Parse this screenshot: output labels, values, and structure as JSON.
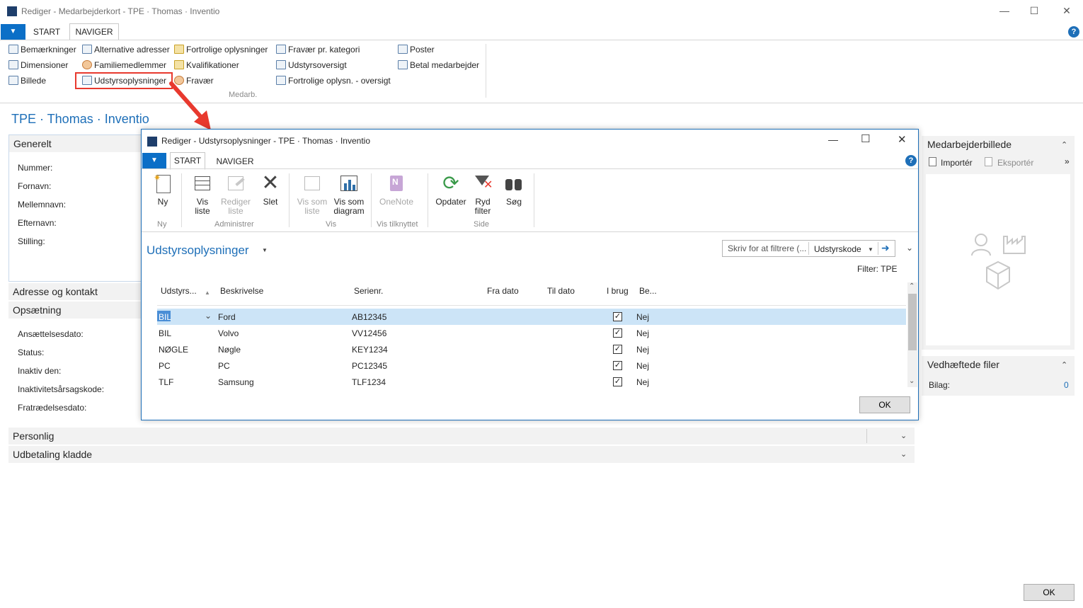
{
  "main_window": {
    "title": "Rediger - Medarbejderkort - TPE · Thomas · Inventio",
    "tabs": [
      "START",
      "NAVIGER"
    ],
    "active_tab": "NAVIGER",
    "ribbon": {
      "col1": [
        "Bemærkninger",
        "Dimensioner",
        "Billede"
      ],
      "col2": [
        "Alternative adresser",
        "Familiemedlemmer",
        "Udstyrsoplysninger"
      ],
      "col3": [
        "Fortrolige oplysninger",
        "Kvalifikationer",
        "Fravær"
      ],
      "col4": [
        "Fravær pr. kategori",
        "Udstyrsoversigt",
        "Fortrolige oplysn. - oversigt"
      ],
      "col5": [
        "Poster",
        "Betal medarbejder"
      ],
      "group_label": "Medarb."
    },
    "page_title": "TPE · Thomas  · Inventio",
    "fasttabs": {
      "generelt": "Generelt",
      "generelt_fields": [
        "Nummer:",
        "Fornavn:",
        "Mellemnavn:",
        "Efternavn:",
        "Stilling:"
      ],
      "adresse": "Adresse og kontakt",
      "opsaetning": "Opsætning",
      "opsaetning_fields": [
        "Ansættelsesdato:",
        "Status:",
        "Inaktiv den:",
        "Inaktivitetsårsagskode:",
        "Fratrædelsesdato:"
      ],
      "personlig": "Personlig",
      "udbetaling": "Udbetaling kladde"
    },
    "factbox": {
      "picture_title": "Medarbejderbillede",
      "import_label": "Importér",
      "export_label": "Eksportér",
      "attachments_title": "Vedhæftede filer",
      "bilag_label": "Bilag:",
      "bilag_value": "0"
    },
    "ok_label": "OK"
  },
  "modal": {
    "title": "Rediger - Udstyrsoplysninger - TPE · Thomas · Inventio",
    "tabs": [
      "START",
      "NAVIGER"
    ],
    "active_tab": "START",
    "ribbon": {
      "ny": "Ny",
      "vis_liste": "Vis\nliste",
      "rediger_liste": "Rediger\nliste",
      "slet": "Slet",
      "vis_som_liste": "Vis som\nliste",
      "vis_som_diagram": "Vis som\ndiagram",
      "onenote": "OneNote",
      "opdater": "Opdater",
      "ryd_filter": "Ryd\nfilter",
      "soeg": "Søg",
      "groups": [
        "Ny",
        "Administrer",
        "Vis",
        "Vis tilknyttet",
        "Side"
      ]
    },
    "list_title": "Udstyrsoplysninger",
    "filter_placeholder": "Skriv for at filtrere (...",
    "filter_field": "Udstyrskode",
    "filter_text": "Filter: TPE",
    "columns": [
      "Udstyrs...",
      "Beskrivelse",
      "Serienr.",
      "Fra dato",
      "Til dato",
      "I brug",
      "Be..."
    ],
    "rows": [
      {
        "code": "BIL",
        "desc": "Ford",
        "serial": "AB12345",
        "in_use": true,
        "be": "Nej"
      },
      {
        "code": "BIL",
        "desc": "Volvo",
        "serial": "VV12456",
        "in_use": true,
        "be": "Nej"
      },
      {
        "code": "NØGLE",
        "desc": "Nøgle",
        "serial": "KEY1234",
        "in_use": true,
        "be": "Nej"
      },
      {
        "code": "PC",
        "desc": "PC",
        "serial": "PC12345",
        "in_use": true,
        "be": "Nej"
      },
      {
        "code": "TLF",
        "desc": "Samsung",
        "serial": "TLF1234",
        "in_use": true,
        "be": "Nej"
      }
    ],
    "ok_label": "OK"
  },
  "colors": {
    "accent_blue": "#1e6fb8",
    "highlight_red": "#e8392e",
    "selected_row": "#cce4f7"
  }
}
